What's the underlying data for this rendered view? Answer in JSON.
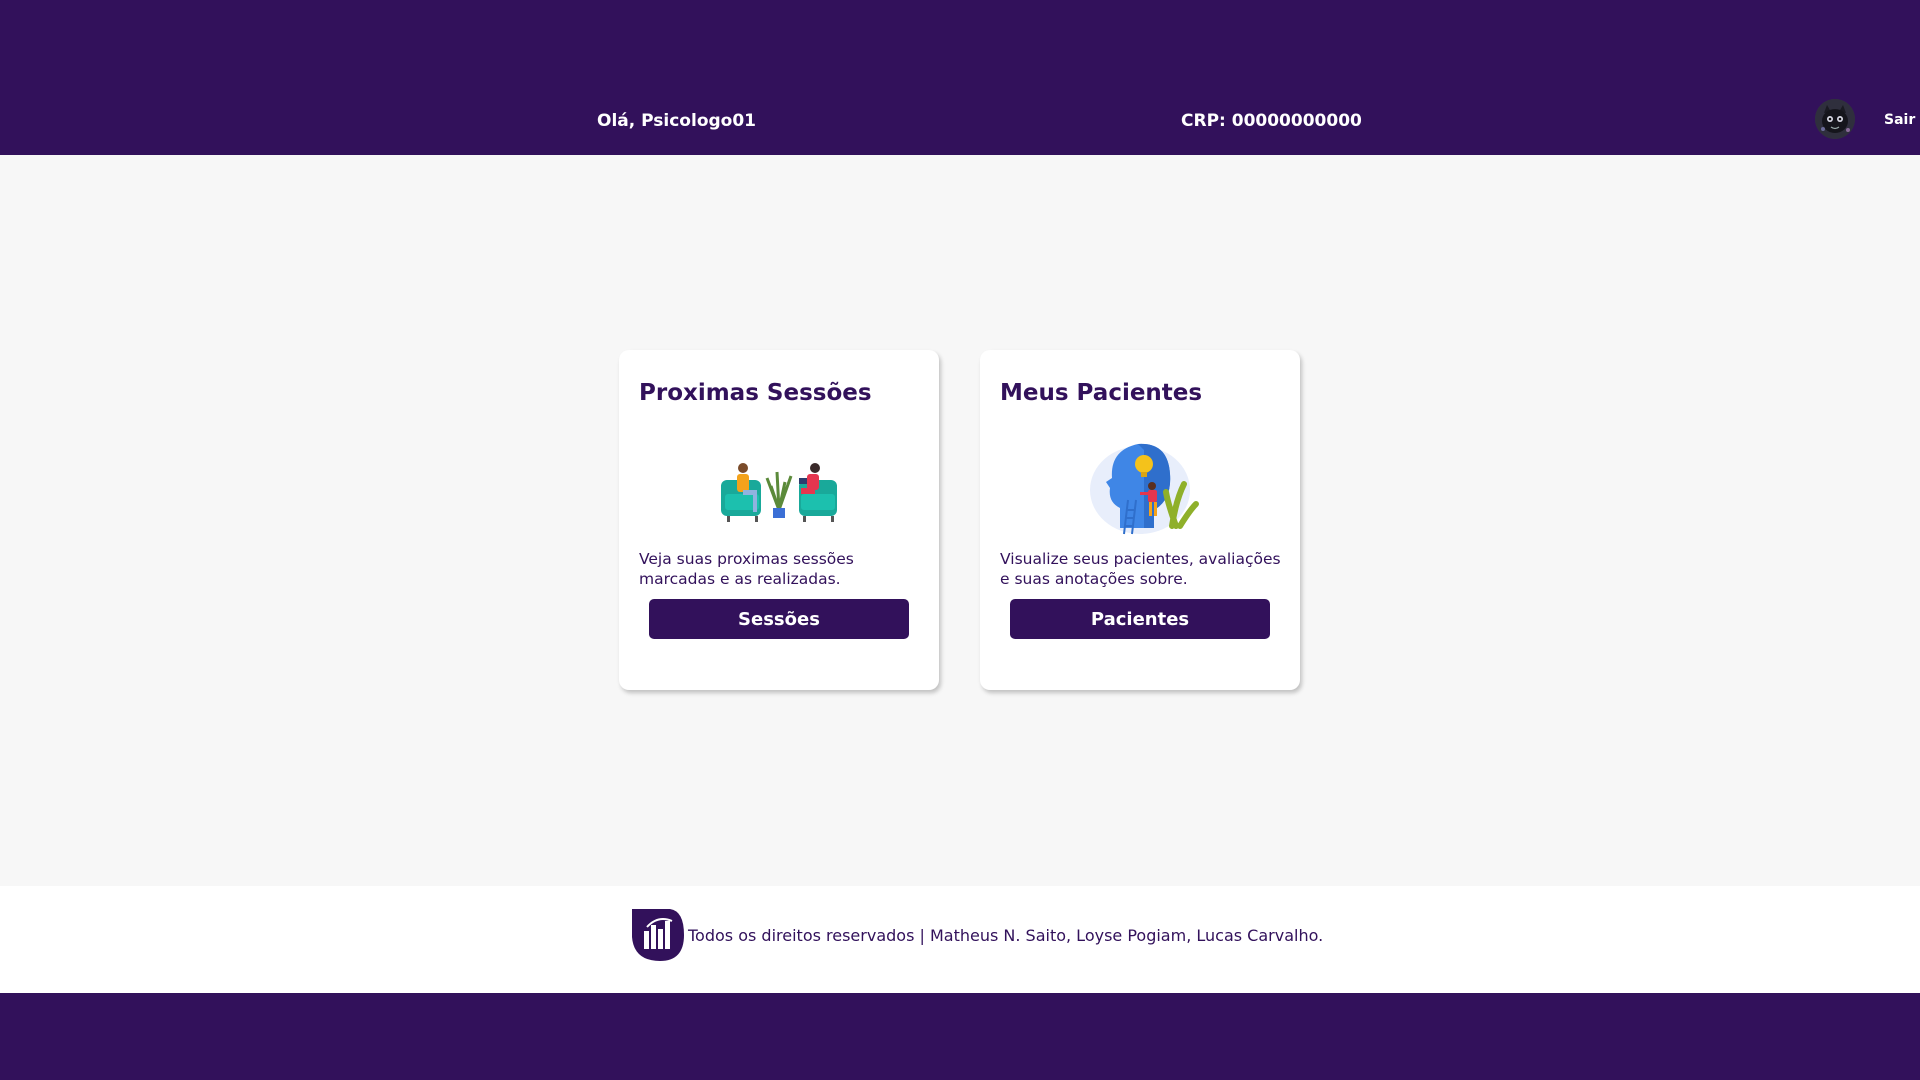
{
  "header": {
    "greeting": "Olá, Psicologo01",
    "crp": "CRP: 00000000000",
    "logout_label": "Sair"
  },
  "cards": [
    {
      "title": "Proximas Sessões",
      "description": "Veja suas proximas sessões marcadas e as realizadas.",
      "button_label": "Sessões",
      "illustration": "therapy-session-illustration"
    },
    {
      "title": "Meus Pacientes",
      "description": "Visualize seus pacientes, avaliações e suas anotações sobre.",
      "button_label": "Pacientes",
      "illustration": "patient-mind-illustration"
    }
  ],
  "footer": {
    "logo_icon": "app-logo-icon",
    "text": "Todos os direitos reservados | Matheus N. Saito, Loyse Pogiam, Lucas Carvalho."
  },
  "colors": {
    "primary": "#32115b",
    "background": "#f7f7f7",
    "card": "#ffffff"
  }
}
